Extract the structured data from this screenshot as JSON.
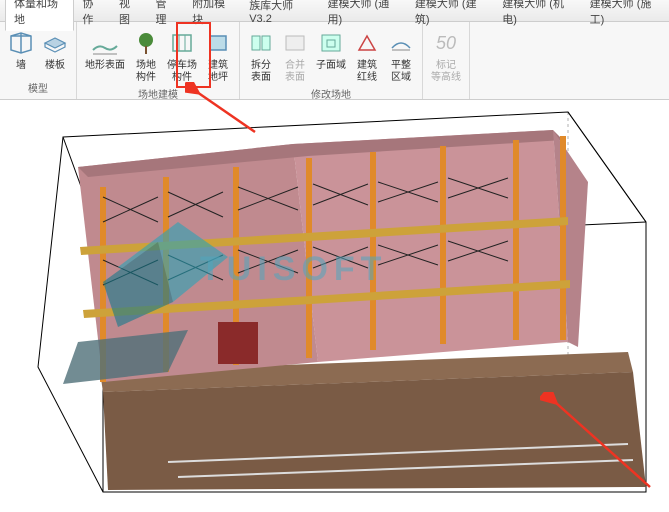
{
  "tabs": {
    "items": [
      {
        "label": "体量和场地",
        "active": true
      },
      {
        "label": "协作"
      },
      {
        "label": "视图"
      },
      {
        "label": "管理"
      },
      {
        "label": "附加模块"
      },
      {
        "label": "族库大师V3.2"
      },
      {
        "label": "建模大师 (通用)"
      },
      {
        "label": "建模大师 (建筑)"
      },
      {
        "label": "建模大师 (机电)"
      },
      {
        "label": "建模大师 (施工)"
      }
    ]
  },
  "ribbon": {
    "group_model": {
      "label": "模型",
      "wall": "墙",
      "floor": "楼板"
    },
    "group_site": {
      "label": "场地建模",
      "topo": "地形表面",
      "site_comp1": "场地",
      "site_comp2": "构件",
      "parking1": "停车场",
      "parking2": "构件",
      "pad1": "建筑",
      "pad2": "地坪"
    },
    "group_modify": {
      "label": "修改场地",
      "split1": "拆分",
      "split2": "表面",
      "merge1": "合并",
      "merge2": "表面",
      "sub": "子面域",
      "line1": "建筑",
      "line2": "红线",
      "grade": "平整",
      "grade2": "区域"
    },
    "group_label": {
      "num": "50",
      "label1": "标记",
      "label2": "等高线"
    }
  },
  "watermark": "TUISOFT",
  "annotation": {
    "highlight_target": "building-pad-button"
  }
}
